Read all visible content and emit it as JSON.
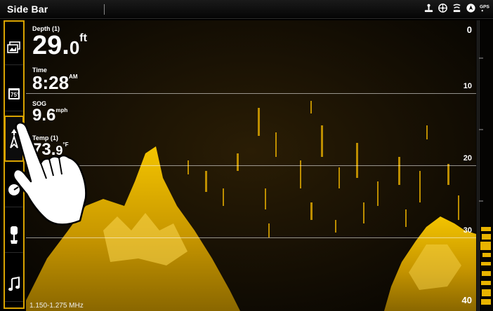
{
  "topbar": {
    "title": "Side Bar",
    "status_icons": [
      "transducer-icon",
      "helm-wheel-icon",
      "sonar-icon",
      "navigation-icon",
      "gps-icon"
    ]
  },
  "sidebar": {
    "items": [
      {
        "name": "sidebar-item-views",
        "icon": "views-icon"
      },
      {
        "name": "sidebar-item-temp",
        "icon": "temperature-icon",
        "text": "75°"
      },
      {
        "name": "sidebar-item-navigation",
        "icon": "navigation-icon",
        "selected": true
      },
      {
        "name": "sidebar-item-controls",
        "icon": "gauge-icon"
      },
      {
        "name": "sidebar-item-trolling-motor",
        "icon": "trolling-motor-icon"
      },
      {
        "name": "sidebar-item-music",
        "icon": "music-note-icon"
      }
    ]
  },
  "readouts": {
    "depth": {
      "label": "Depth (1)",
      "value": "29.",
      "value_dec": "0",
      "unit": "ft"
    },
    "time": {
      "label": "Time",
      "value": "8:28",
      "unit": "AM"
    },
    "sog": {
      "label": "SOG",
      "value": "9.6",
      "unit": "mph"
    },
    "temp": {
      "label": "Temp (1)",
      "value": "73.",
      "value_dec": "9",
      "unit": "°F"
    },
    "partial": "V"
  },
  "depth_scale": [
    "0",
    "10",
    "20",
    "30",
    "40"
  ],
  "frequency": "1.150-1.275 MHz",
  "colors": {
    "accent": "#d9a300",
    "sonar_gold": "#e8b400"
  }
}
